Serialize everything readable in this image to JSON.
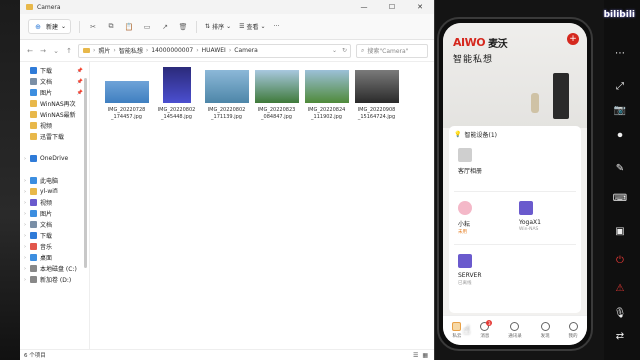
{
  "explorer": {
    "title": "Camera",
    "toolbar": {
      "new_label": "新建",
      "sort_label": "排序",
      "view_label": "查看",
      "more_label": "···"
    },
    "breadcrumb": [
      "照片",
      "智能私想",
      "14000000007",
      "HUAWEI",
      "Camera"
    ],
    "search_placeholder": "搜索\"Camera\"",
    "sidebar": [
      {
        "label": "下载",
        "pinned": true,
        "icon": "download-icon",
        "color": "#2f7bd8",
        "chevron": false
      },
      {
        "label": "文档",
        "pinned": true,
        "icon": "document-icon",
        "color": "#7a8fa6",
        "chevron": false
      },
      {
        "label": "图片",
        "pinned": true,
        "icon": "pictures-icon",
        "color": "#3c8ee0",
        "chevron": false
      },
      {
        "label": "WinNAS再次",
        "pinned": false,
        "icon": "folder-icon",
        "color": "#e8b84a",
        "chevron": false
      },
      {
        "label": "WinNAS最新",
        "pinned": false,
        "icon": "folder-icon",
        "color": "#e8b84a",
        "chevron": false
      },
      {
        "label": "视频",
        "pinned": false,
        "icon": "folder-icon",
        "color": "#e8b84a",
        "chevron": false
      },
      {
        "label": "迅雷下载",
        "pinned": false,
        "icon": "folder-icon",
        "color": "#e8b84a",
        "chevron": false
      },
      {
        "label": "",
        "pinned": false,
        "icon": "",
        "color": "",
        "chevron": false
      },
      {
        "label": "OneDrive",
        "pinned": false,
        "icon": "cloud-icon",
        "color": "#2f7bd8",
        "chevron": true
      },
      {
        "label": "",
        "pinned": false,
        "icon": "",
        "color": "",
        "chevron": false
      },
      {
        "label": "此电脑",
        "pinned": false,
        "icon": "computer-icon",
        "color": "#3c8ee0",
        "chevron": true
      },
      {
        "label": "yl-wifi",
        "pinned": false,
        "icon": "folder-icon",
        "color": "#e8b84a",
        "chevron": true
      },
      {
        "label": "视频",
        "pinned": false,
        "icon": "video-icon",
        "color": "#6a5acd",
        "chevron": true
      },
      {
        "label": "图片",
        "pinned": false,
        "icon": "pictures-icon",
        "color": "#3c8ee0",
        "chevron": true
      },
      {
        "label": "文档",
        "pinned": false,
        "icon": "document-icon",
        "color": "#7a8fa6",
        "chevron": true
      },
      {
        "label": "下载",
        "pinned": false,
        "icon": "download-icon",
        "color": "#2f7bd8",
        "chevron": true
      },
      {
        "label": "音乐",
        "pinned": false,
        "icon": "music-icon",
        "color": "#e2574c",
        "chevron": true
      },
      {
        "label": "桌面",
        "pinned": false,
        "icon": "desktop-icon",
        "color": "#3c8ee0",
        "chevron": true
      },
      {
        "label": "本地磁盘 (C:)",
        "pinned": false,
        "icon": "drive-icon",
        "color": "#888888",
        "chevron": true
      },
      {
        "label": "新加卷 (D:)",
        "pinned": false,
        "icon": "drive-icon",
        "color": "#888888",
        "chevron": true
      }
    ],
    "files": [
      {
        "name": "IMG_20220728_174457.jpg",
        "colors": [
          "#6fa3d8",
          "#3f7fc0"
        ],
        "portrait": false
      },
      {
        "name": "IMG_20220802_145448.jpg",
        "colors": [
          "#2b2a7a",
          "#4b4fd0"
        ],
        "portrait": true
      },
      {
        "name": "IMG_20220802_171139.jpg",
        "colors": [
          "#8cb8d8",
          "#4d86a8"
        ],
        "portrait": false
      },
      {
        "name": "IMG_20220823_084847.jpg",
        "colors": [
          "#a8c8e0",
          "#3f7a3a"
        ],
        "portrait": false
      },
      {
        "name": "IMG_20220824_111902.jpg",
        "colors": [
          "#9cc0d8",
          "#4f8a3a"
        ],
        "portrait": false
      },
      {
        "name": "IMG_20220908_151647 24.jpg",
        "colors": [
          "#7a7a7a",
          "#2a2a2a"
        ],
        "portrait": false
      }
    ],
    "file_names_display": [
      [
        "IMG_20220728",
        "_174457.jpg"
      ],
      [
        "IMG_20220802",
        "_145448.jpg"
      ],
      [
        "IMG_20220802",
        "_171139.jpg"
      ],
      [
        "IMG_20220823",
        "_084847.jpg"
      ],
      [
        "IMG_20220824",
        "_111902.jpg"
      ],
      [
        "IMG_20220908",
        "_15164724.jpg"
      ]
    ],
    "status": "6 个项目"
  },
  "phone": {
    "brand_en": "AIWO",
    "brand_cn": "麦沃",
    "slogan": "智能私想",
    "devices_header": "智能设备(1)",
    "devices": [
      {
        "name": "客厅相册",
        "sub": "",
        "icon": "album-icon"
      },
      {
        "name": "小耘",
        "sub": "未用",
        "icon": "avatar-icon"
      },
      {
        "name": "YogaX1",
        "sub": "Win-NAS",
        "icon": "laptop-icon"
      },
      {
        "name": "SERVER",
        "sub": "已离线",
        "icon": "laptop-icon"
      }
    ],
    "nav": [
      {
        "label": "私云",
        "badge": ""
      },
      {
        "label": "消息",
        "badge": "3"
      },
      {
        "label": "通讯录",
        "badge": ""
      },
      {
        "label": "发现",
        "badge": ""
      },
      {
        "label": "我的",
        "badge": ""
      }
    ]
  },
  "overlay": {
    "logo_text": "bilibili"
  }
}
